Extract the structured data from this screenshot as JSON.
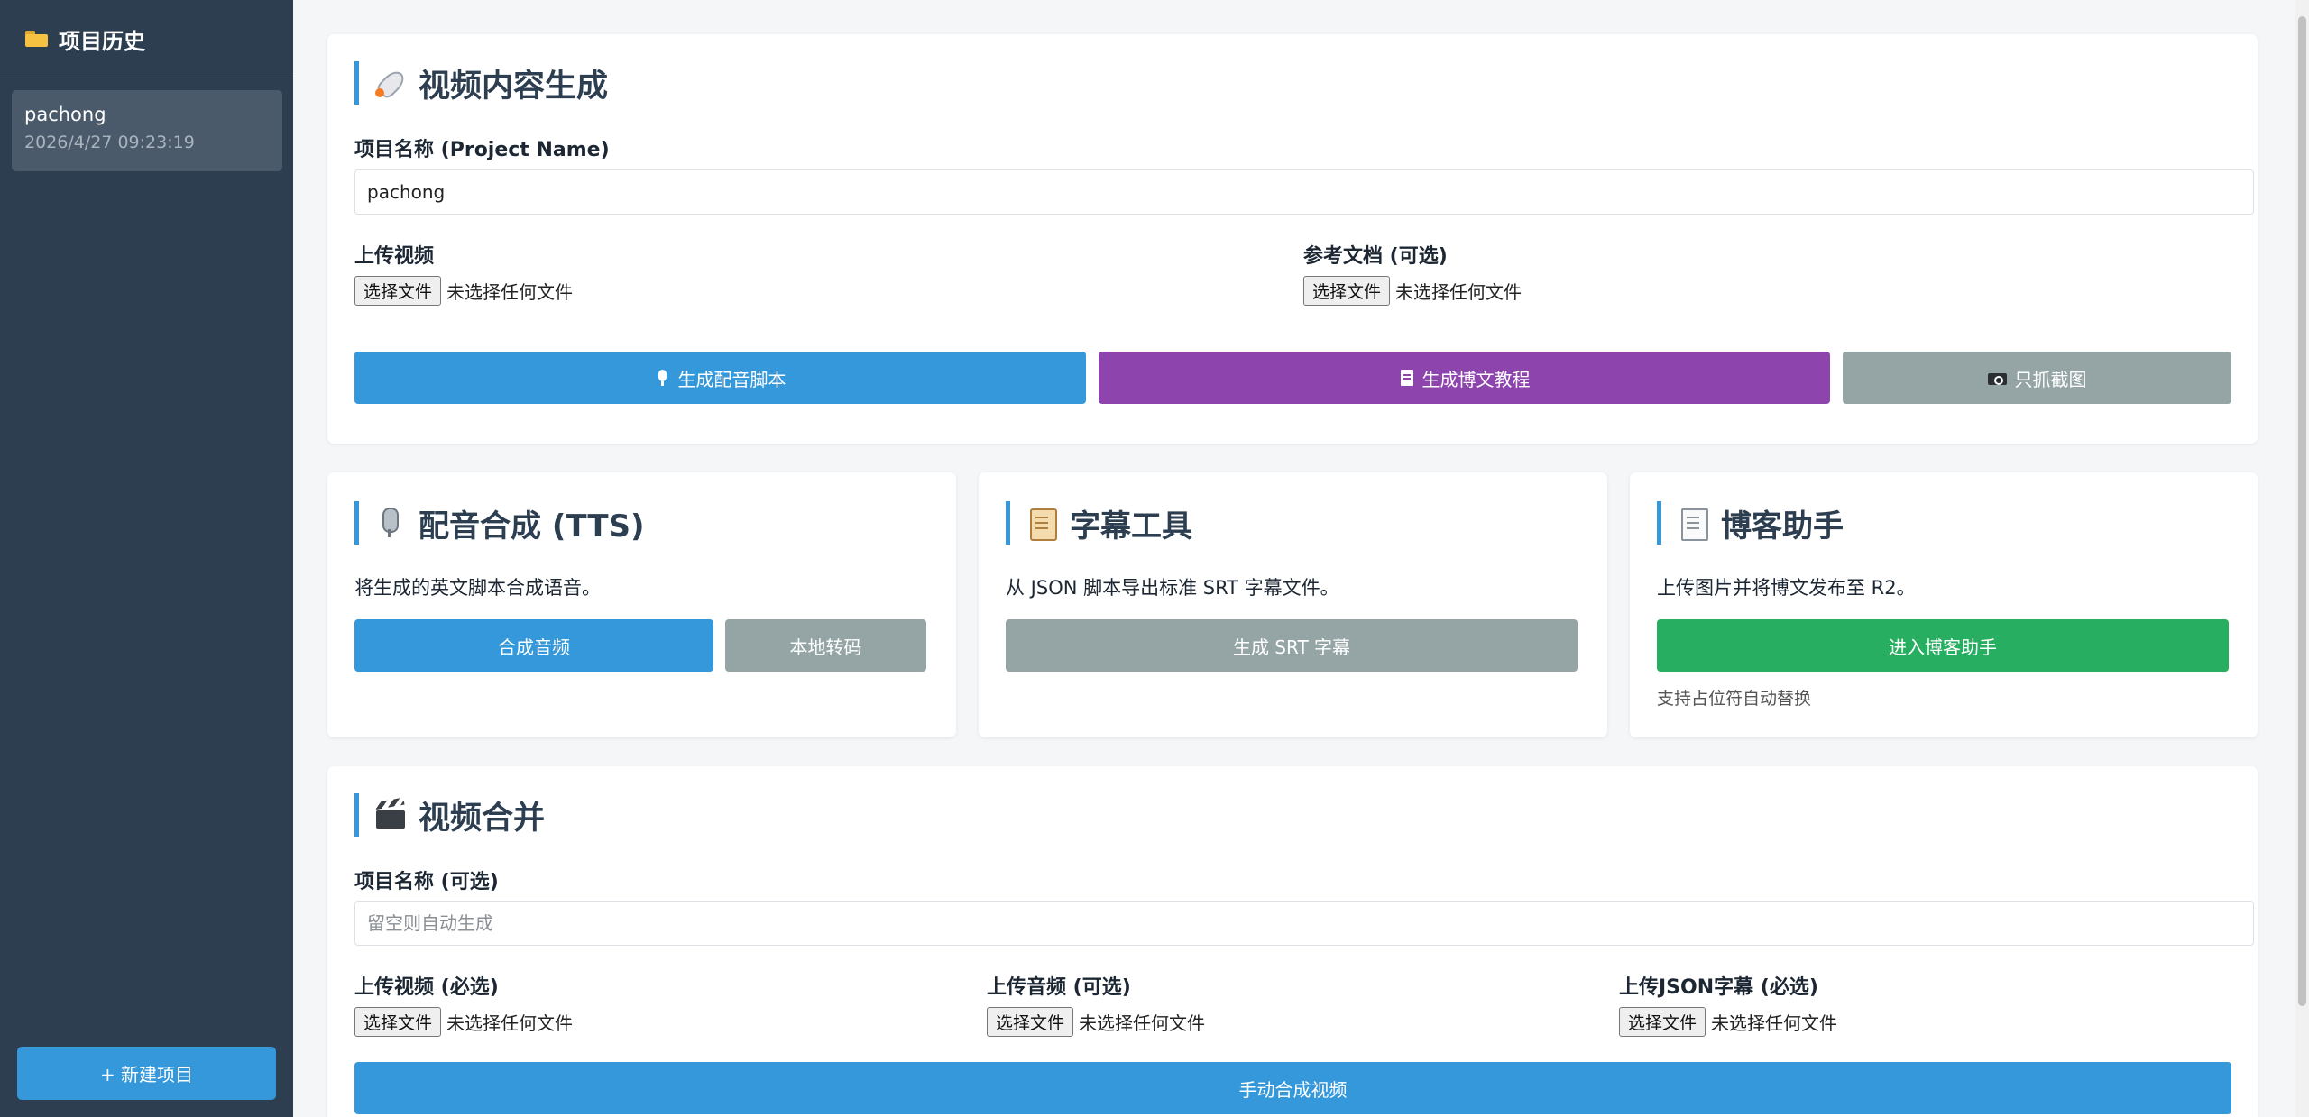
{
  "sidebar": {
    "title": "项目历史",
    "history": [
      {
        "name": "pachong",
        "time": "2026/4/27 09:23:19"
      }
    ],
    "new_project_label": "+ 新建项目"
  },
  "content_gen": {
    "title": "视频内容生成",
    "project_name_label": "项目名称 (Project Name)",
    "project_name_value": "pachong",
    "upload_video_label": "上传视频",
    "reference_doc_label": "参考文档 (可选)",
    "file_button_label": "选择文件",
    "no_file_text": "未选择任何文件",
    "btn_voice_script": "生成配音脚本",
    "btn_blog_tutorial": "生成博文教程",
    "btn_screenshots": "只抓截图"
  },
  "tts": {
    "title": "配音合成 (TTS)",
    "desc": "将生成的英文脚本合成语音。",
    "btn_synth": "合成音频",
    "btn_local": "本地转码"
  },
  "subtitle": {
    "title": "字幕工具",
    "desc": "从 JSON 脚本导出标准 SRT 字幕文件。",
    "btn_srt": "生成 SRT 字幕"
  },
  "blog": {
    "title": "博客助手",
    "desc": "上传图片并将博文发布至 R2。",
    "btn_enter": "进入博客助手",
    "note": "支持占位符自动替换"
  },
  "merge": {
    "title": "视频合并",
    "project_name_label": "项目名称 (可选)",
    "project_name_placeholder": "留空则自动生成",
    "upload_video_label": "上传视频 (必选)",
    "upload_audio_label": "上传音频 (可选)",
    "upload_json_label": "上传JSON字幕 (必选)",
    "file_button_label": "选择文件",
    "no_file_text": "未选择任何文件",
    "btn_merge": "手动合成视频"
  },
  "colors": {
    "sidebar_bg": "#2c3e50",
    "accent_blue": "#3498db",
    "purple": "#8e44ad",
    "gray": "#95a5a6",
    "green": "#27ae60"
  }
}
